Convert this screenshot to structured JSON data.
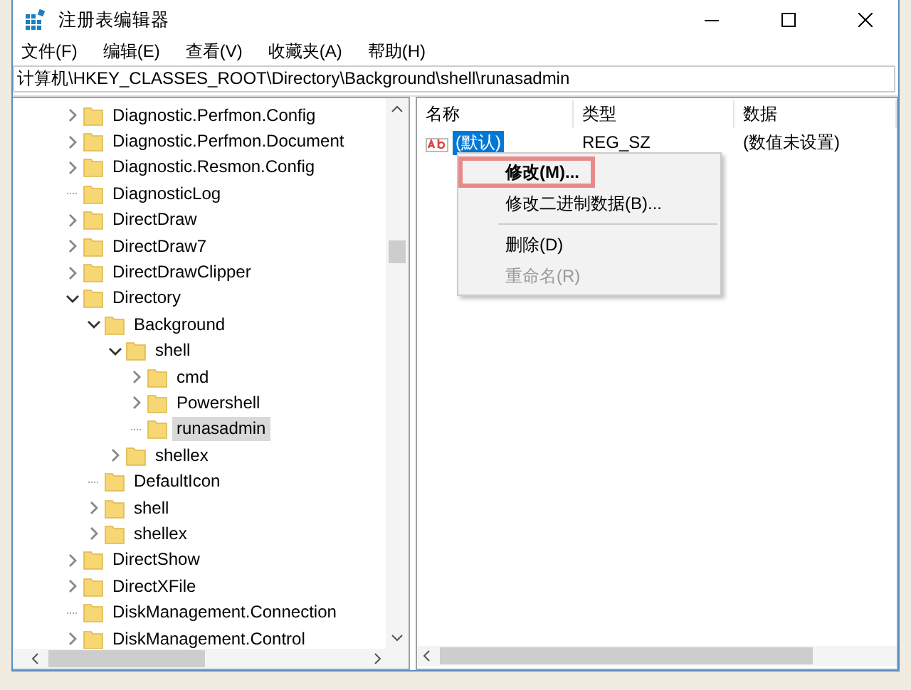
{
  "window": {
    "title": "注册表编辑器"
  },
  "menu": [
    "文件(F)",
    "编辑(E)",
    "查看(V)",
    "收藏夹(A)",
    "帮助(H)"
  ],
  "address": "计算机\\HKEY_CLASSES_ROOT\\Directory\\Background\\shell\\runasadmin",
  "tree": [
    {
      "label": "Diagnostic.Perfmon.Config",
      "kind": "branch",
      "expanded": false,
      "selected": false
    },
    {
      "label": "Diagnostic.Perfmon.Document",
      "kind": "branch",
      "expanded": false,
      "selected": false
    },
    {
      "label": "Diagnostic.Resmon.Config",
      "kind": "branch",
      "expanded": false,
      "selected": false
    },
    {
      "label": "DiagnosticLog",
      "kind": "leaf",
      "selected": false
    },
    {
      "label": "DirectDraw",
      "kind": "branch",
      "expanded": false,
      "selected": false
    },
    {
      "label": "DirectDraw7",
      "kind": "branch",
      "expanded": false,
      "selected": false
    },
    {
      "label": "DirectDrawClipper",
      "kind": "branch",
      "expanded": false,
      "selected": false
    },
    {
      "label": "Directory",
      "kind": "branch",
      "expanded": true,
      "selected": false,
      "children": [
        {
          "label": "Background",
          "kind": "branch",
          "expanded": true,
          "selected": false,
          "children": [
            {
              "label": "shell",
              "kind": "branch",
              "expanded": true,
              "selected": false,
              "children": [
                {
                  "label": "cmd",
                  "kind": "branch",
                  "expanded": false,
                  "selected": false
                },
                {
                  "label": "Powershell",
                  "kind": "branch",
                  "expanded": false,
                  "selected": false
                },
                {
                  "label": "runasadmin",
                  "kind": "leaf",
                  "selected": true
                }
              ]
            },
            {
              "label": "shellex",
              "kind": "branch",
              "expanded": false,
              "selected": false
            }
          ]
        },
        {
          "label": "DefaultIcon",
          "kind": "leaf",
          "selected": false
        },
        {
          "label": "shell",
          "kind": "branch",
          "expanded": false,
          "selected": false
        },
        {
          "label": "shellex",
          "kind": "branch",
          "expanded": false,
          "selected": false
        }
      ]
    },
    {
      "label": "DirectShow",
      "kind": "branch",
      "expanded": false,
      "selected": false
    },
    {
      "label": "DirectXFile",
      "kind": "branch",
      "expanded": false,
      "selected": false
    },
    {
      "label": "DiskManagement.Connection",
      "kind": "leaf",
      "selected": false
    },
    {
      "label": "DiskManagement.Control",
      "kind": "branch",
      "expanded": false,
      "selected": false
    }
  ],
  "values": {
    "columns": [
      "名称",
      "类型",
      "数据"
    ],
    "rows": [
      {
        "name": "(默认)",
        "type": "REG_SZ",
        "data": "(数值未设置)",
        "selected": true
      }
    ]
  },
  "context_menu": [
    {
      "kind": "item",
      "label": "修改(M)...",
      "bold": true,
      "highlighted": true,
      "disabled": false
    },
    {
      "kind": "item",
      "label": "修改二进制数据(B)...",
      "bold": false,
      "highlighted": false,
      "disabled": false
    },
    {
      "kind": "separator"
    },
    {
      "kind": "item",
      "label": "删除(D)",
      "bold": false,
      "highlighted": false,
      "disabled": false
    },
    {
      "kind": "item",
      "label": "重命名(R)",
      "bold": false,
      "highlighted": false,
      "disabled": true
    }
  ]
}
